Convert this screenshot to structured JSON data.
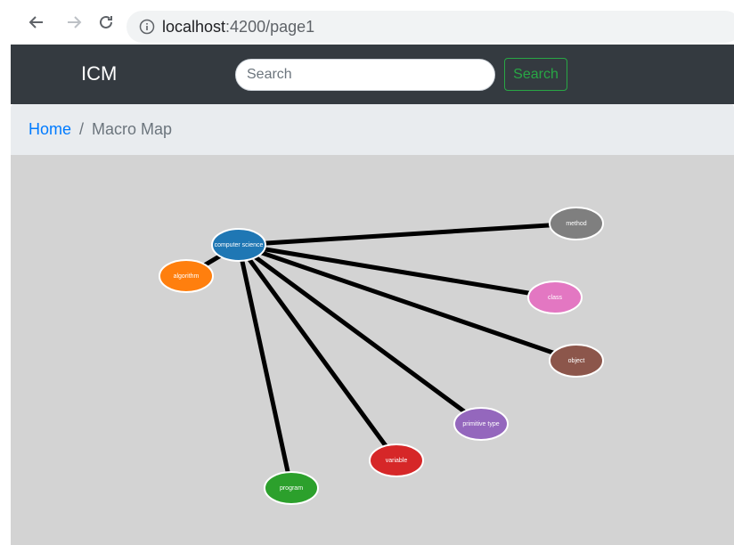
{
  "browser": {
    "url_host": "localhost",
    "url_path": ":4200/page1"
  },
  "navbar": {
    "brand": "ICM",
    "search_placeholder": "Search",
    "search_button": "Search"
  },
  "breadcrumb": {
    "home": "Home",
    "separator": "/",
    "current": "Macro Map"
  },
  "graph": {
    "center": "computer science",
    "nodes": [
      {
        "id": "computer-science",
        "label": "computer science",
        "color": "#1f77b4"
      },
      {
        "id": "algorithm",
        "label": "algorithm",
        "color": "#ff7f0e"
      },
      {
        "id": "method",
        "label": "method",
        "color": "#7f7f7f"
      },
      {
        "id": "class",
        "label": "class",
        "color": "#e377c2"
      },
      {
        "id": "object",
        "label": "object",
        "color": "#8c564b"
      },
      {
        "id": "primitive-type",
        "label": "primitive type",
        "color": "#9467bd"
      },
      {
        "id": "variable",
        "label": "variable",
        "color": "#d62728"
      },
      {
        "id": "program",
        "label": "program",
        "color": "#2ca02c"
      }
    ],
    "edges": [
      {
        "from": "computer-science",
        "to": "algorithm"
      },
      {
        "from": "computer-science",
        "to": "method"
      },
      {
        "from": "computer-science",
        "to": "class"
      },
      {
        "from": "computer-science",
        "to": "object"
      },
      {
        "from": "computer-science",
        "to": "primitive-type"
      },
      {
        "from": "computer-science",
        "to": "variable"
      },
      {
        "from": "computer-science",
        "to": "program"
      }
    ]
  }
}
